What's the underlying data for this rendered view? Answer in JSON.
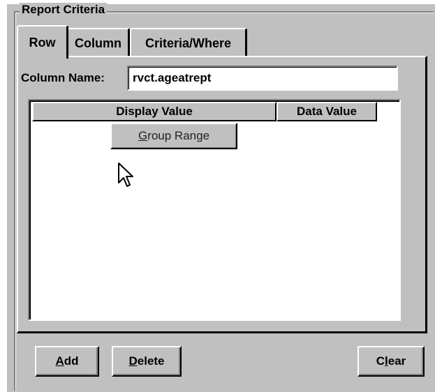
{
  "group_title": "Report Criteria",
  "tabs": [
    {
      "label": "Row",
      "active": true
    },
    {
      "label": "Column",
      "active": false
    },
    {
      "label": "Criteria/Where",
      "active": false
    }
  ],
  "column_name": {
    "label": "Column Name:",
    "value": "rvct.ageatrept"
  },
  "grid": {
    "headers": [
      "Display Value",
      "Data Value"
    ],
    "rows": []
  },
  "popup": {
    "button_label_mnemonic": "G",
    "button_label_rest": "roup Range"
  },
  "buttons": {
    "add": {
      "mnemonic": "A",
      "rest": "dd"
    },
    "delete": {
      "mnemonic": "D",
      "rest": "elete"
    },
    "clear": {
      "pre": "C",
      "mnemonic": "l",
      "rest": "ear"
    }
  },
  "colors": {
    "face": "#c0c0c0",
    "shadow": "#808080",
    "highlight": "#ffffff"
  }
}
